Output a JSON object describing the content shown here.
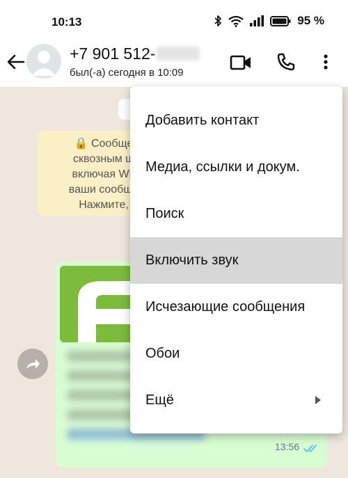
{
  "status_bar": {
    "time": "10:13",
    "battery": "95 %"
  },
  "header": {
    "contact_name": "+7 901 512-",
    "last_seen": "был(-а) сегодня в 10:09"
  },
  "encryption_notice": {
    "lines": [
      "🔒 Сообще",
      "сквозным ш",
      "включая Wh",
      "ваши сообще",
      "Нажмите,"
    ]
  },
  "message": {
    "time": "13:56"
  },
  "menu": {
    "items": [
      {
        "label": "Добавить контакт"
      },
      {
        "label": "Медиа, ссылки и докум."
      },
      {
        "label": "Поиск"
      },
      {
        "label": "Включить звук"
      },
      {
        "label": "Исчезающие сообщения"
      },
      {
        "label": "Обои"
      },
      {
        "label": "Ещё"
      }
    ],
    "highlighted_index": 3
  },
  "colors": {
    "chat_background": "#efe7dd",
    "outgoing_bubble": "#d9fdd3",
    "notice_background": "#fbefc6",
    "read_ticks": "#53bdeb",
    "logo_green": "#7dbb3c"
  },
  "icons": [
    "back-arrow-icon",
    "avatar-icon",
    "video-camera-icon",
    "phone-icon",
    "more-vertical-icon",
    "lock-icon",
    "forward-icon",
    "double-check-icon",
    "chevron-right-icon",
    "wifi-icon",
    "signal-icon",
    "battery-icon",
    "bluetooth-icon"
  ]
}
